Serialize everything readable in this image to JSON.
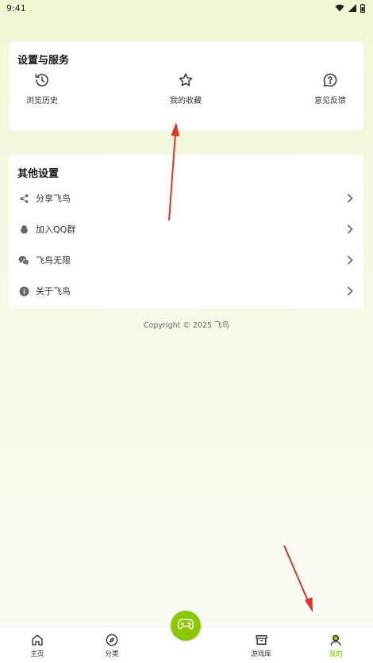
{
  "status_bar": {
    "time": "9:41"
  },
  "services": {
    "title": "设置与服务",
    "items": [
      {
        "label": "浏览历史",
        "icon": "history-icon"
      },
      {
        "label": "我的收藏",
        "icon": "star-icon"
      },
      {
        "label": "意见反馈",
        "icon": "feedback-icon"
      }
    ]
  },
  "other_settings": {
    "title": "其他设置",
    "items": [
      {
        "label": "分享飞鸟",
        "icon": "share-icon"
      },
      {
        "label": "加入QQ群",
        "icon": "qq-icon"
      },
      {
        "label": "飞鸟无限",
        "icon": "wechat-icon"
      },
      {
        "label": "关于飞鸟",
        "icon": "info-icon"
      }
    ]
  },
  "copyright": "Copyright © 2025 飞鸟",
  "tabbar": {
    "items": [
      {
        "label": "主页",
        "icon": "home-icon"
      },
      {
        "label": "分类",
        "icon": "compass-icon"
      },
      {
        "label": "游戏库",
        "icon": "archive-box-icon"
      },
      {
        "label": "我的",
        "icon": "user-icon"
      }
    ],
    "active_index": 3,
    "center_button_icon": "gamepad-icon"
  },
  "colors": {
    "accent": "#8cc800",
    "annotation_arrow": "#e8302a"
  }
}
